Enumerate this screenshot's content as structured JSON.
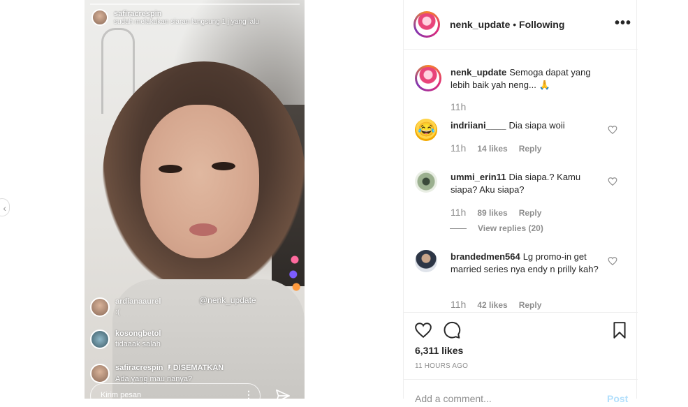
{
  "video": {
    "host_username": "safiracrespin",
    "host_status": "sudah melakukan siaran langsung 1 j yang lalu",
    "mention": "@nenk_update",
    "comments": [
      {
        "username": "ardianaaurel",
        "text": ":("
      },
      {
        "username": "kosongbetol",
        "text": "tidaaak salah"
      },
      {
        "username": "safiracrespin",
        "pinned_label": "🖡 DISEMATKAN",
        "text": "Ada yang mau nanya?"
      }
    ],
    "input_placeholder": "Kirim pesan",
    "more_glyph": "⋮"
  },
  "header": {
    "username": "nenk_update",
    "separator": " • ",
    "follow_status": "Following",
    "more_glyph": "•••"
  },
  "caption": {
    "username": "nenk_update",
    "text": "Semoga dapat yang lebih baik yah neng... 🙏",
    "time": "11h"
  },
  "comments": [
    {
      "username": "indriiani____",
      "text": "Dia siapa woii",
      "time": "11h",
      "likes": "14 likes",
      "reply": "Reply",
      "avatar": "laughing-emoji"
    },
    {
      "username": "ummi_erin11",
      "text": "Dia siapa.? Kamu siapa? Aku siapa?",
      "time": "11h",
      "likes": "89 likes",
      "reply": "Reply",
      "view_replies": "View replies (20)"
    },
    {
      "username": "brandedmen564",
      "text": "Lg promo-in get married series nya endy n prilly kah?",
      "time": "11h",
      "likes": "42 likes",
      "reply": "Reply"
    }
  ],
  "actions": {
    "likes": "6,311 likes",
    "posted_ago": "11 HOURS AGO"
  },
  "add_comment": {
    "placeholder": "Add a comment...",
    "post_label": "Post"
  },
  "nav": {
    "prev_glyph": "‹"
  },
  "colors": {
    "link_blue_disabled": "#b2dffc",
    "muted_text": "#8e8e8e",
    "primary_text": "#262626",
    "border": "#efefef"
  }
}
